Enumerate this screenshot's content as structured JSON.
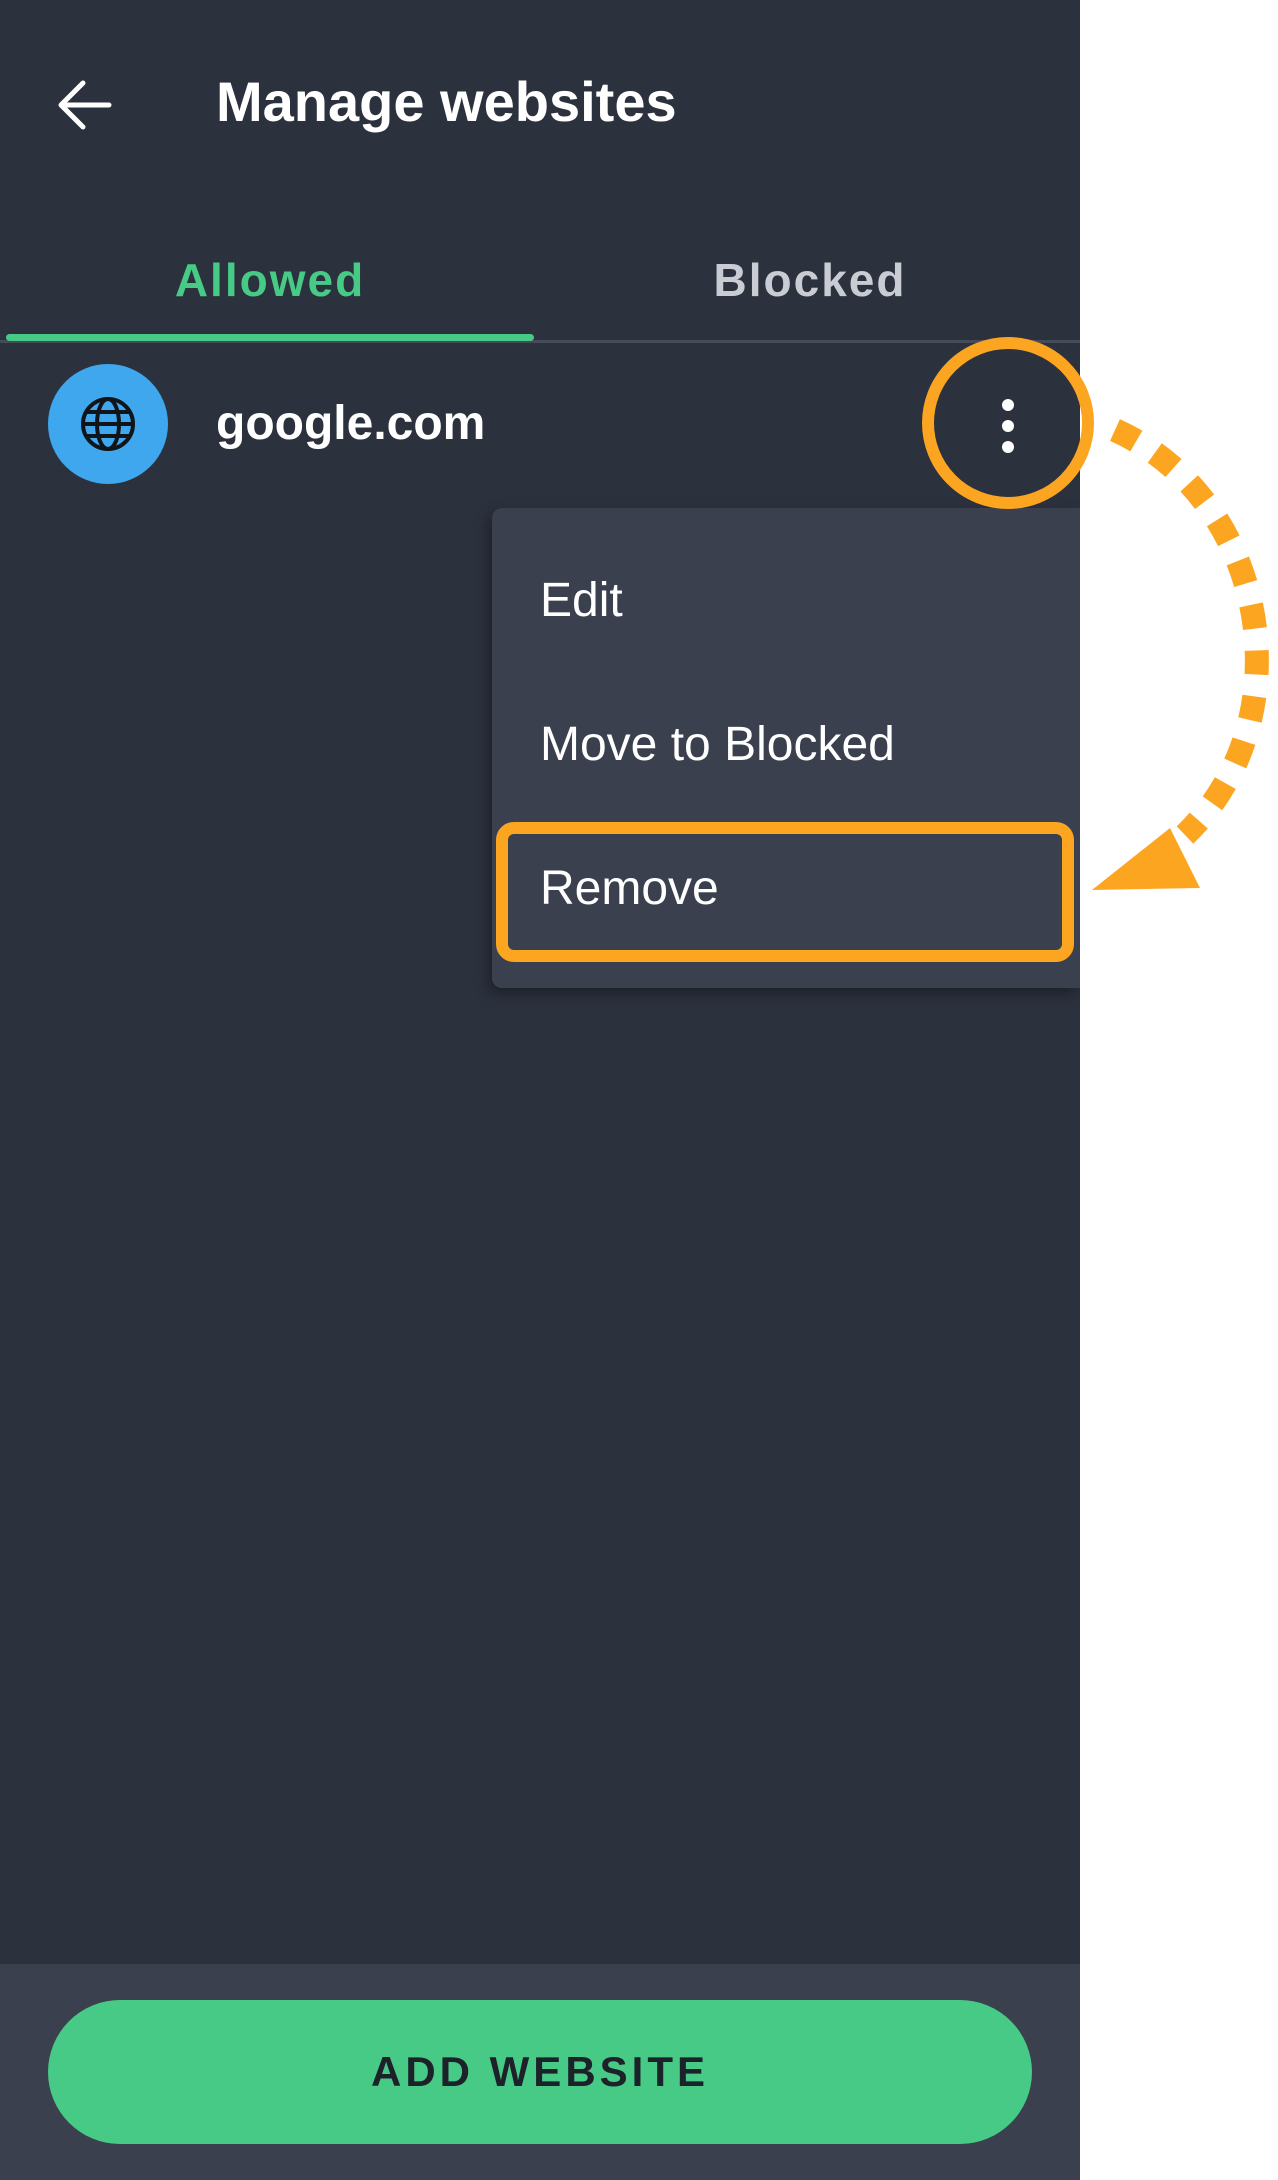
{
  "header": {
    "back_icon": "arrow-left-icon",
    "title": "Manage websites"
  },
  "tabs": [
    {
      "label": "Allowed",
      "active": true
    },
    {
      "label": "Blocked",
      "active": false
    }
  ],
  "websites": [
    {
      "name": "google.com",
      "icon": "globe-icon"
    }
  ],
  "context_menu": {
    "items": [
      {
        "label": "Edit"
      },
      {
        "label": "Move to Blocked"
      },
      {
        "label": "Remove",
        "highlighted": true
      }
    ]
  },
  "footer": {
    "add_button_label": "ADD WEBSITE"
  },
  "colors": {
    "background": "#2c313e",
    "panel": "#3b404f",
    "accent_green": "#47ca86",
    "avatar_blue": "#3ea7ee",
    "annotation_orange": "#fca521"
  }
}
